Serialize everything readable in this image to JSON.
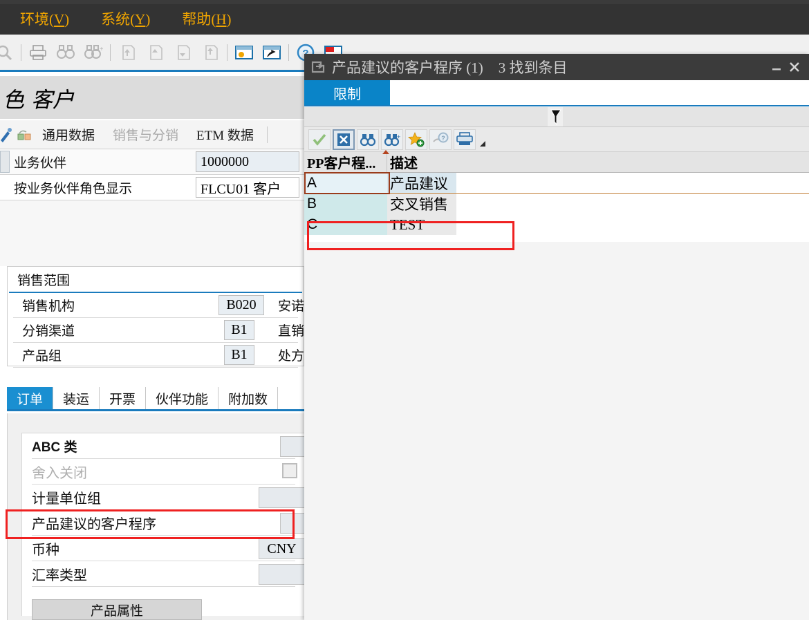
{
  "menubar": {
    "items": [
      {
        "label": "环境(V)",
        "accel": "V",
        "pre": "环境(",
        "post": ")"
      },
      {
        "label": "系统(Y)",
        "accel": "Y",
        "pre": "系统(",
        "post": ")"
      },
      {
        "label": "帮助(H)",
        "accel": "H",
        "pre": "帮助(",
        "post": ")"
      }
    ]
  },
  "toolbar": {
    "icons": [
      "search-icon",
      "print-icon",
      "find-icon",
      "find-next-icon",
      "first-page-icon",
      "previous-page-icon",
      "next-page-icon",
      "last-page-icon",
      "create-session-icon",
      "new-shortcut-icon",
      "help-icon",
      "customize-local-layout-icon"
    ]
  },
  "main": {
    "title": "色 客户",
    "title_glyph": "色",
    "title_text": "客户",
    "subtabs": [
      {
        "label": "通用数据",
        "dim": false
      },
      {
        "label": "销售与分销",
        "dim": true
      },
      {
        "label": "ETM 数据",
        "dim": false
      }
    ],
    "form": [
      {
        "label": "业务伙伴",
        "value": "1000000",
        "field_style": "grey"
      },
      {
        "label": "按业务伙伴角色显示",
        "value": "FLCU01 客户",
        "field_style": "white"
      }
    ],
    "sales_area": {
      "title": "销售范围",
      "rows": [
        {
          "label": "销售机构",
          "code": "B020",
          "desc": "安诺"
        },
        {
          "label": "分销渠道",
          "code": "B1",
          "desc": "直销"
        },
        {
          "label": "产品组",
          "code": "B1",
          "desc": "处方"
        }
      ]
    },
    "tabs": [
      {
        "label": "订单",
        "active": true
      },
      {
        "label": "装运",
        "active": false
      },
      {
        "label": "开票",
        "active": false
      },
      {
        "label": "伙伴功能",
        "active": false
      },
      {
        "label": "附加数",
        "active": false
      }
    ],
    "order_fields": [
      {
        "label": "ABC 类",
        "type": "input",
        "value": "",
        "latin": true,
        "dim": false
      },
      {
        "label": "舍入关闭",
        "type": "checkbox",
        "value": "",
        "latin": false,
        "dim": true
      },
      {
        "label": "计量单位组",
        "type": "input-wide",
        "value": "",
        "latin": false,
        "dim": false
      },
      {
        "label": "产品建议的客户程序",
        "type": "input",
        "value": "",
        "latin": false,
        "dim": false,
        "highlighted": true
      },
      {
        "label": "币种",
        "type": "input-wide",
        "value": "CNY",
        "latin": false,
        "dim": false
      },
      {
        "label": "汇率类型",
        "type": "input-wide",
        "value": "",
        "latin": false,
        "dim": false
      }
    ],
    "product_attributes_button": "产品属性"
  },
  "dialog": {
    "title": "产品建议的客户程序 (1)",
    "count_text": "3 找到条目",
    "icon": "search-help-icon",
    "minimize_label": "—",
    "close_label": "✕",
    "tab_label": "限制",
    "toolbar_icons": [
      "check-icon",
      "cancel-icon",
      "find-icon",
      "find-next-icon",
      "add-favorite-icon",
      "personal-value-list-icon",
      "print-icon",
      "print-dropdown-icon"
    ],
    "table": {
      "columns": [
        "PP客户程...",
        "描述"
      ],
      "rows": [
        {
          "code": "A",
          "desc": "产品建议",
          "selected": true
        },
        {
          "code": "B",
          "desc": "交叉销售",
          "selected": false
        },
        {
          "code": "C",
          "desc": "TEST",
          "selected": false,
          "highlighted": true
        }
      ]
    }
  },
  "colors": {
    "accent_blue": "#1a7bbd",
    "tab_blue": "#0a84c8",
    "menu_orange": "#f0a500",
    "highlight_red": "#ef2121",
    "selection_brown": "#9a3c1b",
    "row_cyan": "#cfe9ea",
    "row_blue": "#e6f2f7"
  }
}
